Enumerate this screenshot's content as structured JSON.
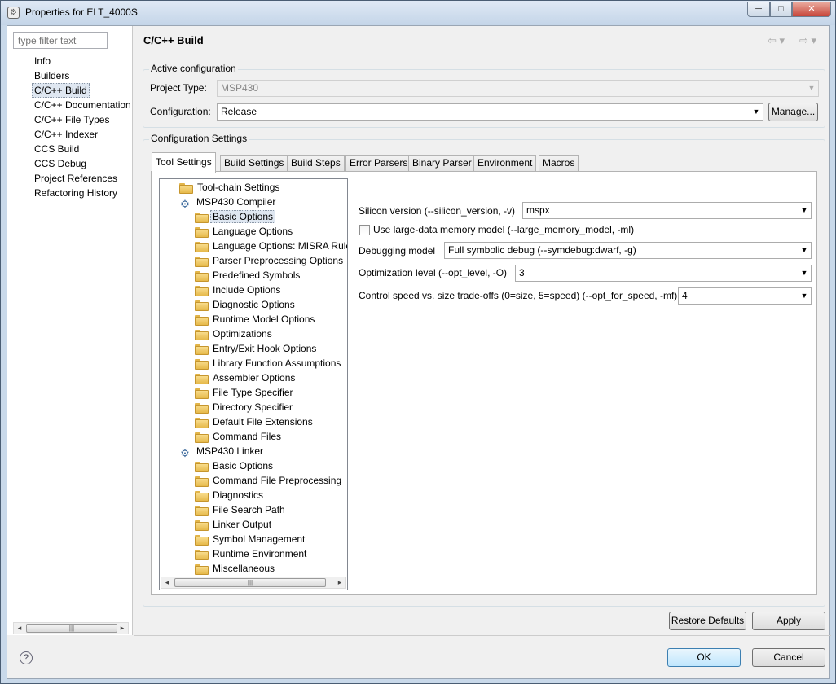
{
  "window": {
    "title": "Properties for ELT_4000S",
    "buttons": {
      "minimize": "─",
      "maximize": "□",
      "close": "✕"
    }
  },
  "sidebar": {
    "filter_placeholder": "type filter text",
    "items": [
      "Info",
      "Builders",
      "C/C++ Build",
      "C/C++ Documentation",
      "C/C++ File Types",
      "C/C++ Indexer",
      "CCS Build",
      "CCS Debug",
      "Project References",
      "Refactoring History"
    ],
    "selected": "C/C++ Build"
  },
  "page": {
    "title": "C/C++ Build",
    "nav_back": "⇦ ▾",
    "nav_forward": "⇨ ▾"
  },
  "active_config": {
    "label": "Active configuration",
    "project_type_label": "Project Type:",
    "project_type_value": "MSP430",
    "configuration_label": "Configuration:",
    "configuration_value": "Release",
    "manage_button": "Manage..."
  },
  "config_settings": {
    "label": "Configuration Settings",
    "tabs": [
      "Tool Settings",
      "Build Settings",
      "Build Steps",
      "Error Parsers",
      "Binary Parser",
      "Environment",
      "Macros"
    ],
    "active_tab": "Tool Settings"
  },
  "tree": {
    "items": [
      {
        "label": "Tool-chain Settings",
        "level": 1,
        "icon": "folder-icon"
      },
      {
        "label": "MSP430 Compiler",
        "level": 1,
        "icon": "gear-icon"
      },
      {
        "label": "Basic Options",
        "level": 2,
        "icon": "folder-icon",
        "selected": true
      },
      {
        "label": "Language Options",
        "level": 2,
        "icon": "folder-icon"
      },
      {
        "label": "Language Options: MISRA Rules",
        "level": 2,
        "icon": "folder-icon"
      },
      {
        "label": "Parser Preprocessing Options",
        "level": 2,
        "icon": "folder-icon"
      },
      {
        "label": "Predefined Symbols",
        "level": 2,
        "icon": "folder-icon"
      },
      {
        "label": "Include Options",
        "level": 2,
        "icon": "folder-icon"
      },
      {
        "label": "Diagnostic Options",
        "level": 2,
        "icon": "folder-icon"
      },
      {
        "label": "Runtime Model Options",
        "level": 2,
        "icon": "folder-icon"
      },
      {
        "label": "Optimizations",
        "level": 2,
        "icon": "folder-icon"
      },
      {
        "label": "Entry/Exit Hook Options",
        "level": 2,
        "icon": "folder-icon"
      },
      {
        "label": "Library Function Assumptions",
        "level": 2,
        "icon": "folder-icon"
      },
      {
        "label": "Assembler Options",
        "level": 2,
        "icon": "folder-icon"
      },
      {
        "label": "File Type Specifier",
        "level": 2,
        "icon": "folder-icon"
      },
      {
        "label": "Directory Specifier",
        "level": 2,
        "icon": "folder-icon"
      },
      {
        "label": "Default File Extensions",
        "level": 2,
        "icon": "folder-icon"
      },
      {
        "label": "Command Files",
        "level": 2,
        "icon": "folder-icon"
      },
      {
        "label": "MSP430 Linker",
        "level": 1,
        "icon": "gear-icon"
      },
      {
        "label": "Basic Options",
        "level": 2,
        "icon": "folder-icon"
      },
      {
        "label": "Command File Preprocessing",
        "level": 2,
        "icon": "folder-icon"
      },
      {
        "label": "Diagnostics",
        "level": 2,
        "icon": "folder-icon"
      },
      {
        "label": "File Search Path",
        "level": 2,
        "icon": "folder-icon"
      },
      {
        "label": "Linker Output",
        "level": 2,
        "icon": "folder-icon"
      },
      {
        "label": "Symbol Management",
        "level": 2,
        "icon": "folder-icon"
      },
      {
        "label": "Runtime Environment",
        "level": 2,
        "icon": "folder-icon"
      },
      {
        "label": "Miscellaneous",
        "level": 2,
        "icon": "folder-icon"
      }
    ]
  },
  "options": {
    "silicon_label": "Silicon version (--silicon_version, -v)",
    "silicon_value": "mspx",
    "large_data_label": "Use large-data memory model (--large_memory_model, -ml)",
    "large_data_checked": false,
    "debug_label": "Debugging model",
    "debug_value": "Full symbolic debug (--symdebug:dwarf, -g)",
    "opt_level_label": "Optimization level (--opt_level, -O)",
    "opt_level_value": "3",
    "speed_label": "Control speed vs. size trade-offs (0=size, 5=speed) (--opt_for_speed, -mf)",
    "speed_value": "4"
  },
  "footer": {
    "restore_defaults": "Restore Defaults",
    "apply": "Apply",
    "ok": "OK",
    "cancel": "Cancel",
    "help": "?"
  },
  "scrollbar": {
    "left_arrow": "◂",
    "right_arrow": "▸",
    "thumb_grip": "|||"
  }
}
